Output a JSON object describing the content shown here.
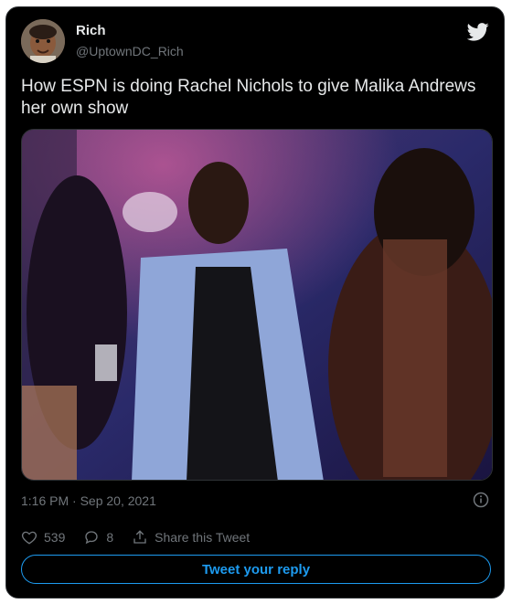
{
  "user": {
    "display_name": "Rich",
    "handle": "@UptownDC_Rich"
  },
  "tweet": {
    "text": "How ESPN is doing Rachel Nichols to give Malika Andrews her own show",
    "timestamp": "1:16 PM · Sep 20, 2021",
    "media_description": "video still of people dancing at a party"
  },
  "actions": {
    "likes": "539",
    "replies": "8",
    "share_label": "Share this Tweet"
  },
  "reply_button": {
    "label": "Tweet your reply"
  },
  "colors": {
    "accent": "#1d9bf0",
    "background": "#000000",
    "text": "#e7e9ea",
    "muted": "#71767b"
  },
  "icons": [
    "twitter-bird-icon",
    "info-icon",
    "heart-icon",
    "reply-icon",
    "share-icon"
  ]
}
